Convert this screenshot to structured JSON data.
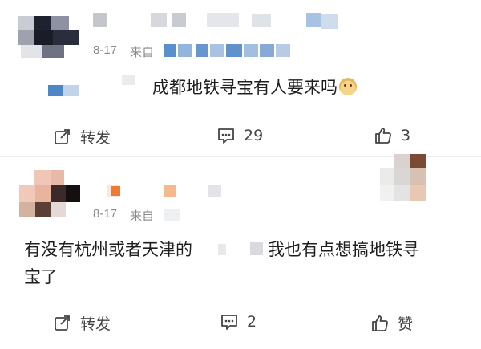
{
  "colors": {
    "meta_text": "#8a8a8a",
    "post_text": "#1f1f1f",
    "action_text": "#444444",
    "pixel_blue": "#4f86c6",
    "pixel_orange": "#f2a45f",
    "divider": "#ededed"
  },
  "post1": {
    "date": "8-17",
    "source_prefix": "来自",
    "text": "成都地铁寻宝有人要来吗",
    "emoji": "doge-emoji",
    "actions": {
      "repost_label": "转发",
      "comment_count": "29",
      "like_count": "3"
    }
  },
  "post2": {
    "date": "8-17",
    "source_prefix": "来自",
    "text_part1": "有没有杭州或者天津的",
    "text_part2": "我也有点想搞地铁寻",
    "text_line2": "宝了",
    "actions": {
      "repost_label": "转发",
      "comment_count": "2",
      "like_label": "赞"
    }
  }
}
